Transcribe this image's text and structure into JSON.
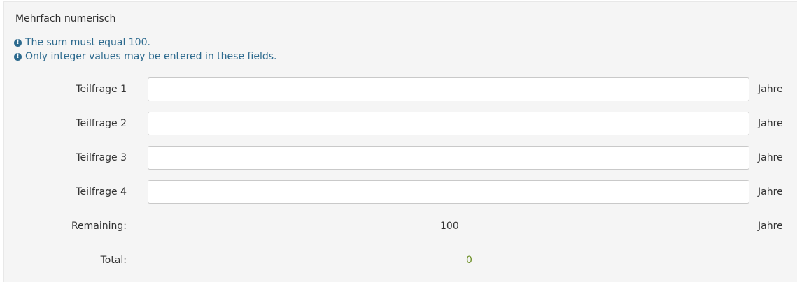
{
  "question": {
    "title": "Mehrfach numerisch",
    "tips": [
      "The sum must equal 100.",
      "Only integer values may be entered in these fields."
    ]
  },
  "rows": [
    {
      "label": "Teilfrage 1",
      "value": "",
      "suffix": "Jahre"
    },
    {
      "label": "Teilfrage 2",
      "value": "",
      "suffix": "Jahre"
    },
    {
      "label": "Teilfrage 3",
      "value": "",
      "suffix": "Jahre"
    },
    {
      "label": "Teilfrage 4",
      "value": "",
      "suffix": "Jahre"
    }
  ],
  "remaining": {
    "label": "Remaining:",
    "value": "100",
    "suffix": "Jahre"
  },
  "total": {
    "label": "Total:",
    "value": "0"
  },
  "colors": {
    "panel_bg": "#f5f5f5",
    "tip_text": "#2d6a8e",
    "total_value": "#6b8e23"
  }
}
